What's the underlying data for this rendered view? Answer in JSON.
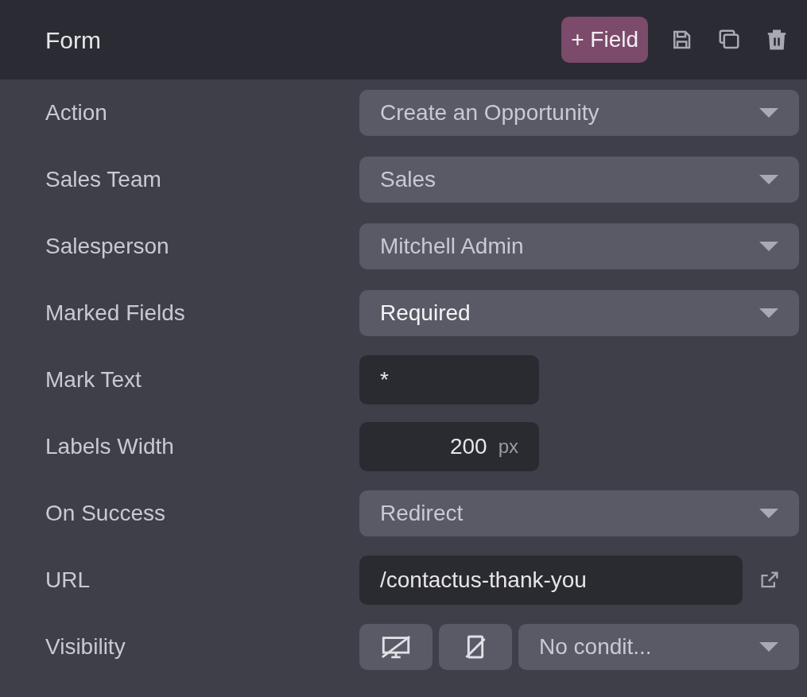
{
  "header": {
    "title": "Form",
    "add_button": "+ Field"
  },
  "rows": [
    {
      "kind": "select",
      "label": "Action",
      "value": "Create an Opportunity",
      "highlighted": false
    },
    {
      "kind": "select",
      "label": "Sales Team",
      "value": "Sales",
      "highlighted": false
    },
    {
      "kind": "select",
      "label": "Salesperson",
      "value": "Mitchell Admin",
      "highlighted": false
    },
    {
      "kind": "select",
      "label": "Marked Fields",
      "value": "Required",
      "highlighted": true
    },
    {
      "kind": "text",
      "label": "Mark Text",
      "value": "*"
    },
    {
      "kind": "unit",
      "label": "Labels Width",
      "value": "200",
      "unit": "px"
    },
    {
      "kind": "select",
      "label": "On Success",
      "value": "Redirect",
      "highlighted": false
    },
    {
      "kind": "link",
      "label": "URL",
      "value": "/contactus-thank-you"
    },
    {
      "kind": "visibility",
      "label": "Visibility",
      "value": "No condit...",
      "highlighted": false
    }
  ]
}
